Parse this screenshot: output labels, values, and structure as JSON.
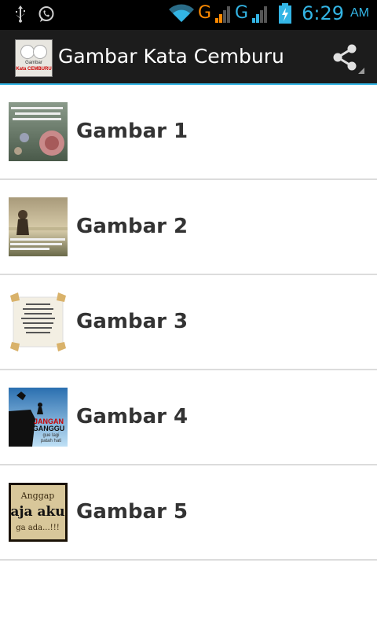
{
  "status": {
    "time": "6:29",
    "ampm": "AM",
    "network1": "G",
    "network2": "G"
  },
  "action_bar": {
    "title": "Gambar Kata Cemburu",
    "icon_caption_1": "Gambar",
    "icon_caption_2": "Kata CEMBURU"
  },
  "list": {
    "items": [
      {
        "label": "Gambar 1"
      },
      {
        "label": "Gambar 2"
      },
      {
        "label": "Gambar 3"
      },
      {
        "label": "Gambar 4"
      },
      {
        "label": "Gambar 5"
      }
    ]
  },
  "thumb_texts": {
    "t4_line1": "JANGAN",
    "t4_line2": "GANGGU",
    "t4_line3": "gue lagi",
    "t4_line4": "patah hati",
    "t5_line1": "Anggap",
    "t5_line2": "aja aku",
    "t5_line3": "ga ada...!!!"
  },
  "colors": {
    "accent": "#33b5e5",
    "signal_orange": "#ff8a00",
    "action_bar": "#1c1c1c",
    "divider": "#dcdcdc"
  }
}
